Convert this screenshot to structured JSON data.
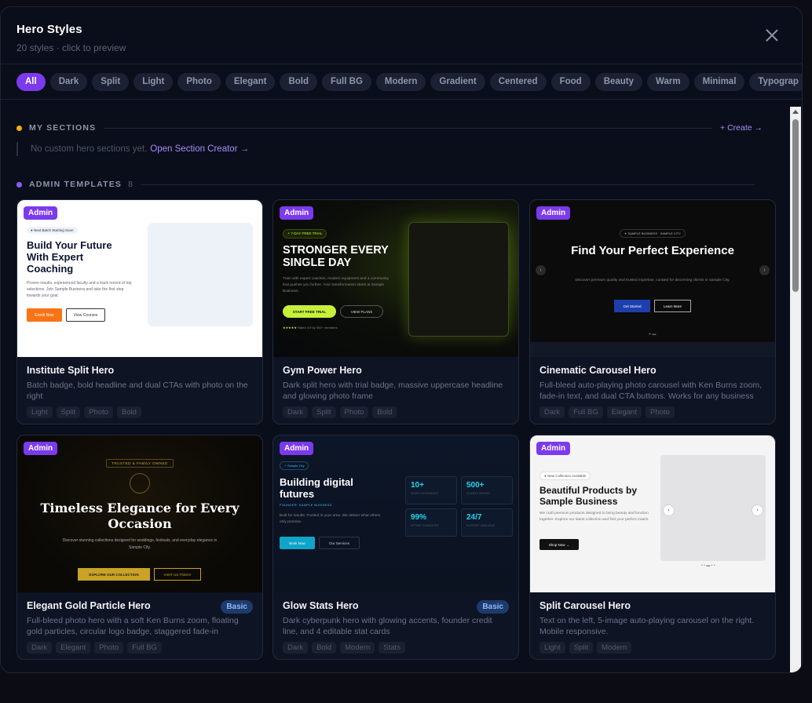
{
  "modal": {
    "title": "Hero Styles",
    "subtitle": "20 styles · click to preview"
  },
  "filters": [
    "All",
    "Dark",
    "Split",
    "Light",
    "Photo",
    "Elegant",
    "Bold",
    "Full BG",
    "Modern",
    "Gradient",
    "Centered",
    "Food",
    "Beauty",
    "Warm",
    "Minimal",
    "Typograp"
  ],
  "active_filter": "All",
  "my_sections": {
    "heading": "MY SECTIONS",
    "create_label": "+ Create →",
    "empty_text": "No custom hero sections yet.",
    "open_link": "Open Section Creator →"
  },
  "admin_templates": {
    "heading": "ADMIN TEMPLATES",
    "count": "8"
  },
  "badges": {
    "admin": "Admin",
    "basic": "Basic"
  },
  "cards": [
    {
      "name": "Institute Split Hero",
      "desc": "Batch badge, bold headline and dual CTAs with photo on the right",
      "tags": [
        "Light",
        "Split",
        "Photo",
        "Bold"
      ],
      "preview": {
        "pill": "● Next Batch Starting Soon",
        "headline": "Build Your Future With Expert Coaching",
        "body": "Proven results, experienced faculty and a track record of top selections. Join Sample Business and take the first step towards your goal.",
        "cta1": "Enroll Now",
        "cta2": "View Courses"
      }
    },
    {
      "name": "Gym Power Hero",
      "desc": "Dark split hero with trial badge, massive uppercase headline and glowing photo frame",
      "tags": [
        "Dark",
        "Split",
        "Photo",
        "Bold"
      ],
      "preview": {
        "pill": "⚡ 7-DAY FREE TRIAL",
        "headline": "STRONGER EVERY SINGLE DAY",
        "body": "Train with expert coaches, modern equipment and a community that pushes you further. Your transformation starts at Sample Business.",
        "cta1": "START FREE TRIAL",
        "cta2": "VIEW PLANS",
        "rating_stars": "★★★★★",
        "rating": "Rated 4.9 by 900+ members"
      }
    },
    {
      "name": "Cinematic Carousel Hero",
      "desc": "Full-bleed auto-playing photo carousel with Ken Burns zoom, fade-in text, and dual CTA buttons. Works for any business —...",
      "tags": [
        "Dark",
        "Full BG",
        "Elegant",
        "Photo"
      ],
      "preview": {
        "pill": "✦ SAMPLE BUSINESS · SAMPLE CITY",
        "headline": "Find Your Perfect Experience",
        "body": "Discover premium quality and trusted expertise, curated for discerning clients in Sample City.",
        "cta1": "Get Started",
        "cta2": "Learn More",
        "prev": "‹",
        "next": "›",
        "dots": "● ▬"
      }
    },
    {
      "name": "Elegant Gold Particle Hero",
      "desc": "Full-bleed photo hero with a soft Ken Burns zoom, floating gold particles, circular logo badge, staggered fade-in entrance, dua...",
      "tags": [
        "Dark",
        "Elegant",
        "Photo",
        "Full BG"
      ],
      "basic": true,
      "preview": {
        "pill": "TRUSTED & FAMILY OWNED",
        "headline": "Timeless Elegance for Every Occasion",
        "body": "Discover stunning collections designed for weddings, festivals, and everyday elegance in Sample City.",
        "cta1": "EXPLORE OUR COLLECTION",
        "cta2": "VISIT US TODAY"
      }
    },
    {
      "name": "Glow Stats Hero",
      "desc": "Dark cyberpunk hero with glowing accents, founder credit line, and 4 editable stat cards",
      "tags": [
        "Dark",
        "Bold",
        "Modern",
        "Stats"
      ],
      "basic": true,
      "preview": {
        "pill": "⚡ Sample City",
        "headline": "Building digital futures",
        "founder": "FOUNDER: SAMPLE BUSINESS",
        "body": "Built for results. Trusted in your area. We deliver what others only promise.",
        "cta1": "Book Now",
        "cta2": "Our Services",
        "stats": [
          {
            "value": "10+",
            "label": "YEARS EXPERIENCE"
          },
          {
            "value": "500+",
            "label": "CLIENTS SERVED"
          },
          {
            "value": "99%",
            "label": "UPTIME GUARANTEE"
          },
          {
            "value": "24/7",
            "label": "SUPPORT AVAILABLE"
          }
        ]
      }
    },
    {
      "name": "Split Carousel Hero",
      "desc": "Text on the left, 5-image auto-playing carousel on the right. Mobile responsive.",
      "tags": [
        "Light",
        "Split",
        "Modern"
      ],
      "preview": {
        "pill": "● New Collection Available",
        "headline": "Beautiful Products by Sample Business",
        "body": "We craft premium products designed to bring beauty and function together. Explore our latest collection and find your perfect match.",
        "cta1": "Shop Now →",
        "prev": "‹",
        "next": "›",
        "dots": "• • ▬ • •"
      }
    }
  ],
  "colors": {
    "accent": "#7c3aed",
    "my_sections_dot": "#f5b000",
    "admin_dot": "#8b5cf6",
    "link": "#a78bfa"
  },
  "icons": {
    "close": "close-icon"
  }
}
